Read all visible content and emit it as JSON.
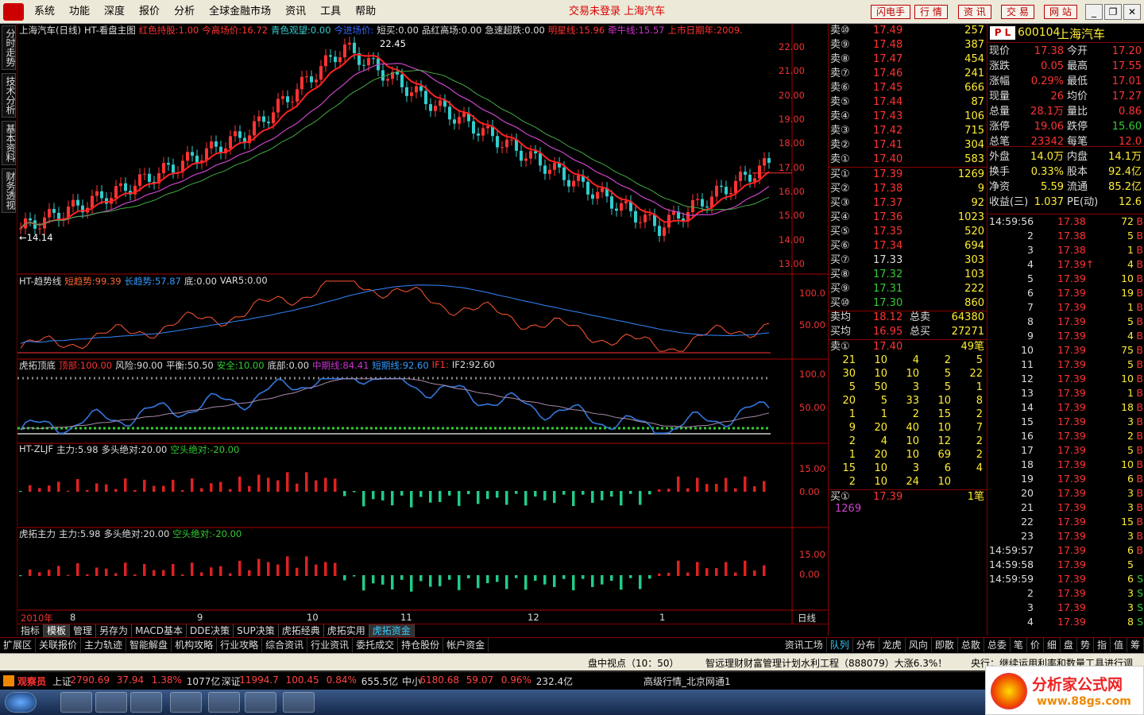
{
  "menu": {
    "items": [
      "系统",
      "功能",
      "深度",
      "报价",
      "分析",
      "全球金融市场",
      "资讯",
      "工具",
      "帮助"
    ],
    "center": "交易未登录  上海汽车",
    "right": [
      "闪电手",
      "行  情",
      "资  讯",
      "交  易",
      "网  站"
    ]
  },
  "sidetabs": [
    "分时走势",
    "技术分析",
    "基本资料",
    "财务透视"
  ],
  "main_panel": {
    "title": "上海汽车(日线)",
    "indicator": "HT-看盘主图",
    "params": [
      {
        "k": "红色持股:",
        "v": "1.00",
        "c": "#ff3333"
      },
      {
        "k": "今高场价:",
        "v": "16.72",
        "c": "#ff3333"
      },
      {
        "k": "青色观望:",
        "v": "0.00",
        "c": "#33cccc"
      },
      {
        "k": "今进场价:",
        "v": "",
        "c": "#3366ff"
      },
      {
        "k": "短买:",
        "v": "0.00",
        "c": "#dddddd"
      },
      {
        "k": "品红高场:",
        "v": "0.00",
        "c": "#dddddd"
      },
      {
        "k": "急速超跌:",
        "v": "0.00",
        "c": "#dddddd"
      },
      {
        "k": "明星线:",
        "v": "15.96",
        "c": "#ff3333"
      },
      {
        "k": "牵牛线:",
        "v": "15.57",
        "c": "#cc33cc"
      },
      {
        "k": "上市日期年:",
        "v": "2009.",
        "c": "#ff3333"
      }
    ],
    "high_label": "22.45",
    "low_label": "←14.14",
    "yaxis": [
      "22.00",
      "21.00",
      "20.00",
      "19.00",
      "18.00",
      "17.00",
      "16.00",
      "15.00",
      "14.00",
      "13.00"
    ]
  },
  "panel2": {
    "name": "HT-趋势线",
    "params": [
      {
        "k": "短趋势:",
        "v": "99.39",
        "c": "#ff6633"
      },
      {
        "k": "长趋势:",
        "v": "57.87",
        "c": "#3399ff"
      },
      {
        "k": "底:",
        "v": "0.00",
        "c": "#dddddd"
      },
      {
        "k": "VAR5:",
        "v": "0.00",
        "c": "#dddddd"
      }
    ],
    "yaxis": [
      "100.0",
      "50.00"
    ]
  },
  "panel3": {
    "name": "虎拓顶底",
    "params": [
      {
        "k": "顶部:",
        "v": "100.00",
        "c": "#ff3333"
      },
      {
        "k": "风险:",
        "v": "90.00",
        "c": "#dddddd"
      },
      {
        "k": "平衡:",
        "v": "50.50",
        "c": "#dddddd"
      },
      {
        "k": "安全:",
        "v": "10.00",
        "c": "#33cc33"
      },
      {
        "k": "底部:",
        "v": "0.00",
        "c": "#dddddd"
      },
      {
        "k": "中期线:",
        "v": "84.41",
        "c": "#cc33cc"
      },
      {
        "k": "短期线:",
        "v": "92.60",
        "c": "#3399ff"
      },
      {
        "k": "IF1:",
        "v": "",
        "c": "#ff3333"
      },
      {
        "k": "IF2:",
        "v": "92.60",
        "c": "#dddddd"
      }
    ],
    "yaxis": [
      "100.0",
      "50.00"
    ]
  },
  "panel4": {
    "name": "HT-ZLJF",
    "params": [
      {
        "k": "主力:",
        "v": "5.98",
        "c": "#dddddd"
      },
      {
        "k": "多头绝对:",
        "v": "20.00",
        "c": "#dddddd"
      },
      {
        "k": "空头绝对:",
        "v": "-20.00",
        "c": "#33cc33"
      }
    ],
    "yaxis": [
      "15.00",
      "0.00"
    ]
  },
  "panel5": {
    "name": "虎拓主力",
    "params": [
      {
        "k": "主力:",
        "v": "5.98",
        "c": "#dddddd"
      },
      {
        "k": "多头绝对:",
        "v": "20.00",
        "c": "#dddddd"
      },
      {
        "k": "空头绝对:",
        "v": "-20.00",
        "c": "#33cc33"
      }
    ],
    "yaxis": [
      "15.00",
      "0.00"
    ]
  },
  "xaxis": {
    "year": "2010年",
    "months": [
      "8",
      "9",
      "10",
      "11",
      "12",
      "1"
    ],
    "period": "日线"
  },
  "bottomtabs": [
    "指标",
    "模板",
    "管理",
    "另存为",
    "MACD基本",
    "DDE决策",
    "SUP决策",
    "虎拓经典",
    "虎拓实用",
    "虎拓资金"
  ],
  "bottomtabs2": [
    "扩展区",
    "关联报价",
    "主力轨迹",
    "智能解盘",
    "机构攻略",
    "行业攻略",
    "综合资讯",
    "行业资讯",
    "委托成交",
    "持仓股份",
    "帐户资金"
  ],
  "bottomtabs2_right": [
    "资讯工场",
    "队列",
    "分布",
    "龙虎",
    "风向",
    "即散",
    "总散",
    "总委",
    "笔",
    "价",
    "细",
    "盘",
    "势",
    "指",
    "值",
    "筹"
  ],
  "orderbook": {
    "asks": [
      [
        "卖⑩",
        "17.49",
        "257"
      ],
      [
        "卖⑨",
        "17.48",
        "387"
      ],
      [
        "卖⑧",
        "17.47",
        "454"
      ],
      [
        "卖⑦",
        "17.46",
        "241"
      ],
      [
        "卖⑥",
        "17.45",
        "666"
      ],
      [
        "卖⑤",
        "17.44",
        "87"
      ],
      [
        "卖④",
        "17.43",
        "106"
      ],
      [
        "卖③",
        "17.42",
        "715"
      ],
      [
        "卖②",
        "17.41",
        "304"
      ],
      [
        "卖①",
        "17.40",
        "583"
      ]
    ],
    "bids": [
      [
        "买①",
        "17.39",
        "1269"
      ],
      [
        "买②",
        "17.38",
        "9"
      ],
      [
        "买③",
        "17.37",
        "92"
      ],
      [
        "买④",
        "17.36",
        "1023"
      ],
      [
        "买⑤",
        "17.35",
        "520"
      ],
      [
        "买⑥",
        "17.34",
        "694"
      ],
      [
        "买⑦",
        "17.33",
        "303"
      ],
      [
        "买⑧",
        "17.32",
        "103"
      ],
      [
        "买⑨",
        "17.31",
        "222"
      ],
      [
        "买⑩",
        "17.30",
        "860"
      ]
    ],
    "avg": [
      [
        "卖均",
        "18.12",
        "总卖",
        "64380"
      ],
      [
        "买均",
        "16.95",
        "总买",
        "27271"
      ]
    ],
    "queue_sell": {
      "label": "卖①",
      "price": "17.40",
      "count": "49笔"
    },
    "queue": [
      [
        "21",
        "10",
        "4",
        "2",
        "5"
      ],
      [
        "30",
        "10",
        "10",
        "5",
        "22"
      ],
      [
        "5",
        "50",
        "3",
        "5",
        "1"
      ],
      [
        "20",
        "5",
        "33",
        "10",
        "8"
      ],
      [
        "1",
        "1",
        "2",
        "15",
        "2"
      ],
      [
        "9",
        "20",
        "40",
        "10",
        "7"
      ],
      [
        "2",
        "4",
        "10",
        "12",
        "2"
      ],
      [
        "1",
        "20",
        "10",
        "69",
        "2"
      ],
      [
        "15",
        "10",
        "3",
        "6",
        "4"
      ],
      [
        "2",
        "10",
        "24",
        "10",
        ""
      ]
    ],
    "queue_buy": {
      "label": "买①",
      "price": "17.39",
      "count": "1笔",
      "vol": "1269"
    }
  },
  "quote": {
    "code": "600104",
    "name": "上海汽车",
    "rows": [
      [
        "现价",
        "17.38",
        "今开",
        "17.20"
      ],
      [
        "涨跌",
        "0.05",
        "最高",
        "17.55"
      ],
      [
        "涨幅",
        "0.29%",
        "最低",
        "17.01"
      ],
      [
        "现量",
        "26",
        "均价",
        "17.27"
      ],
      [
        "总量",
        "28.1万",
        "量比",
        "0.86"
      ],
      [
        "涨停",
        "19.06",
        "跌停",
        "15.60"
      ],
      [
        "总笔",
        "23342",
        "每笔",
        "12.0"
      ],
      [
        "外盘",
        "14.0万",
        "内盘",
        "14.1万"
      ],
      [
        "换手",
        "0.33%",
        "股本",
        "92.4亿"
      ],
      [
        "净资",
        "5.59",
        "流通",
        "85.2亿"
      ],
      [
        "收益(三)",
        "1.037",
        "PE(动)",
        "12.6"
      ]
    ],
    "ticks": [
      [
        "14:59:56",
        "17.38",
        "72",
        "B"
      ],
      [
        "2",
        "17.38",
        "5",
        "B"
      ],
      [
        "3",
        "17.38",
        "1",
        "B"
      ],
      [
        "4",
        "17.39↑",
        "4",
        "B"
      ],
      [
        "5",
        "17.39",
        "10",
        "B"
      ],
      [
        "6",
        "17.39",
        "19",
        "B"
      ],
      [
        "7",
        "17.39",
        "1",
        "B"
      ],
      [
        "8",
        "17.39",
        "5",
        "B"
      ],
      [
        "9",
        "17.39",
        "4",
        "B"
      ],
      [
        "10",
        "17.39",
        "75",
        "B"
      ],
      [
        "11",
        "17.39",
        "5",
        "B"
      ],
      [
        "12",
        "17.39",
        "10",
        "B"
      ],
      [
        "13",
        "17.39",
        "1",
        "B"
      ],
      [
        "14",
        "17.39",
        "18",
        "B"
      ],
      [
        "15",
        "17.39",
        "3",
        "B"
      ],
      [
        "16",
        "17.39",
        "2",
        "B"
      ],
      [
        "17",
        "17.39",
        "5",
        "B"
      ],
      [
        "18",
        "17.39",
        "10",
        "B"
      ],
      [
        "19",
        "17.39",
        "6",
        "B"
      ],
      [
        "20",
        "17.39",
        "3",
        "B"
      ],
      [
        "21",
        "17.39",
        "3",
        "B"
      ],
      [
        "22",
        "17.39",
        "15",
        "B"
      ],
      [
        "23",
        "17.39",
        "3",
        "B"
      ],
      [
        "14:59:57",
        "17.39",
        "6",
        "B"
      ],
      [
        "14:59:58",
        "17.39",
        "5",
        ""
      ],
      [
        "14:59:59",
        "17.39",
        "6",
        "S"
      ],
      [
        "2",
        "17.39",
        "3",
        "S"
      ],
      [
        "3",
        "17.39",
        "3",
        "S"
      ],
      [
        "4",
        "17.39",
        "8",
        "S"
      ]
    ]
  },
  "ticker": {
    "left": "盘中视点（10：50）",
    "mid": "智远理财财富管理计划水利工程（888079）大涨6.3%！",
    "right": "央行：继续运用利率和数量工具进行调"
  },
  "status": {
    "user": "观察员",
    "items": [
      {
        "t": "上证",
        "c": "#ddd"
      },
      {
        "t": "2790.69",
        "c": "#ff4444"
      },
      {
        "t": "37.94",
        "c": "#ff4444"
      },
      {
        "t": "1.38%",
        "c": "#ff4444"
      },
      {
        "t": "1077亿",
        "c": "#ddd"
      },
      {
        "t": "深证",
        "c": "#ddd"
      },
      {
        "t": "11994.7",
        "c": "#ff4444"
      },
      {
        "t": "100.45",
        "c": "#ff4444"
      },
      {
        "t": "0.84%",
        "c": "#ff4444"
      },
      {
        "t": "655.5亿",
        "c": "#ddd"
      },
      {
        "t": "中小",
        "c": "#ddd"
      },
      {
        "t": "6180.68",
        "c": "#ff4444"
      },
      {
        "t": "59.07",
        "c": "#ff4444"
      },
      {
        "t": "0.96%",
        "c": "#ff4444"
      },
      {
        "t": "232.4亿",
        "c": "#ddd"
      }
    ],
    "feed": "高级行情_北京网通1"
  },
  "watermark": {
    "title": "分析家公式网",
    "url": "www.88gs.com"
  },
  "colors": {
    "up": "#ff3333",
    "down": "#33cccc",
    "bg": "#000000",
    "axis": "#aa0000"
  }
}
